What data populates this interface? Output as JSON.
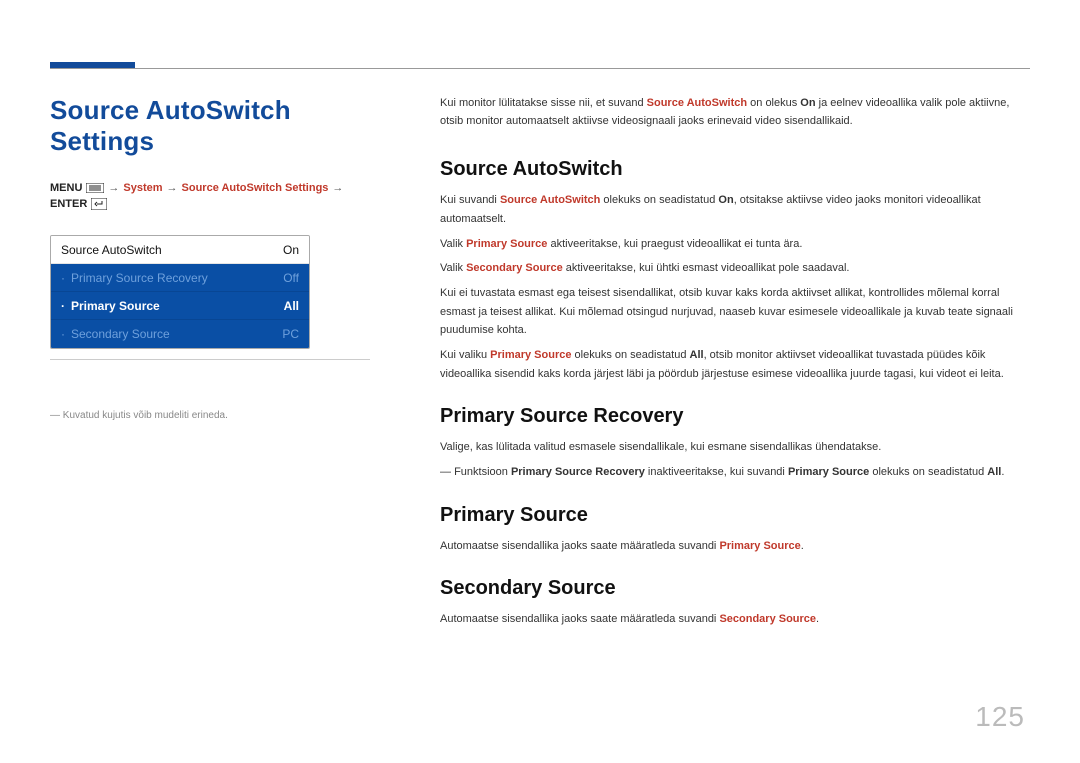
{
  "page_number": "125",
  "left": {
    "title": "Source AutoSwitch Settings",
    "breadcrumb": {
      "menu_label": "MENU",
      "system": "System",
      "settings": "Source AutoSwitch Settings",
      "enter_label": "ENTER"
    },
    "osd": {
      "row0": {
        "label": "Source AutoSwitch",
        "value": "On"
      },
      "row1": {
        "label": "Primary Source Recovery",
        "value": "Off"
      },
      "row2": {
        "label": "Primary Source",
        "value": "All"
      },
      "row3": {
        "label": "Secondary Source",
        "value": "PC"
      }
    },
    "footnote": "Kuvatud kujutis võib mudeliti erineda."
  },
  "right": {
    "intro_pre": "Kui monitor lülitatakse sisse nii, et suvand ",
    "intro_hl1": "Source AutoSwitch",
    "intro_mid1": " on olekus ",
    "intro_hl2": "On",
    "intro_post": " ja eelnev videoallika valik pole aktiivne, otsib monitor automaatselt aktiivse videosignaali jaoks erinevaid video sisendallikaid.",
    "s1": {
      "h": "Source AutoSwitch",
      "p1a": "Kui suvandi ",
      "p1b": "Source AutoSwitch",
      "p1c": " olekuks on seadistatud ",
      "p1d": "On",
      "p1e": ", otsitakse aktiivse video jaoks monitori videoallikat automaatselt.",
      "p2a": "Valik ",
      "p2b": "Primary Source",
      "p2c": " aktiveeritakse, kui praegust videoallikat ei tunta ära.",
      "p3a": "Valik ",
      "p3b": "Secondary Source",
      "p3c": " aktiveeritakse, kui ühtki esmast videoallikat pole saadaval.",
      "p4": "Kui ei tuvastata esmast ega teisest sisendallikat, otsib kuvar kaks korda aktiivset allikat, kontrollides mõlemal korral esmast ja teisest allikat. Kui mõlemad otsingud nurjuvad, naaseb kuvar esimesele videoallikale ja kuvab teate signaali puudumise kohta.",
      "p5a": "Kui valiku ",
      "p5b": "Primary Source",
      "p5c": " olekuks on seadistatud ",
      "p5d": "All",
      "p5e": ", otsib monitor aktiivset videoallikat tuvastada püüdes kõik videoallika sisendid kaks korda järjest läbi ja pöördub järjestuse esimese videoallika juurde tagasi, kui videot ei leita."
    },
    "s2": {
      "h": "Primary Source Recovery",
      "p1": "Valige, kas lülitada valitud esmasele sisendallikale, kui esmane sisendallikas ühendatakse.",
      "note_a": "Funktsioon ",
      "note_b": "Primary Source Recovery",
      "note_c": " inaktiveeritakse, kui suvandi ",
      "note_d": "Primary Source",
      "note_e": " olekuks on seadistatud ",
      "note_f": "All",
      "note_g": "."
    },
    "s3": {
      "h": "Primary Source",
      "p1a": "Automaatse sisendallika jaoks saate määratleda suvandi ",
      "p1b": "Primary Source",
      "p1c": "."
    },
    "s4": {
      "h": "Secondary Source",
      "p1a": "Automaatse sisendallika jaoks saate määratleda suvandi ",
      "p1b": "Secondary Source",
      "p1c": "."
    }
  }
}
